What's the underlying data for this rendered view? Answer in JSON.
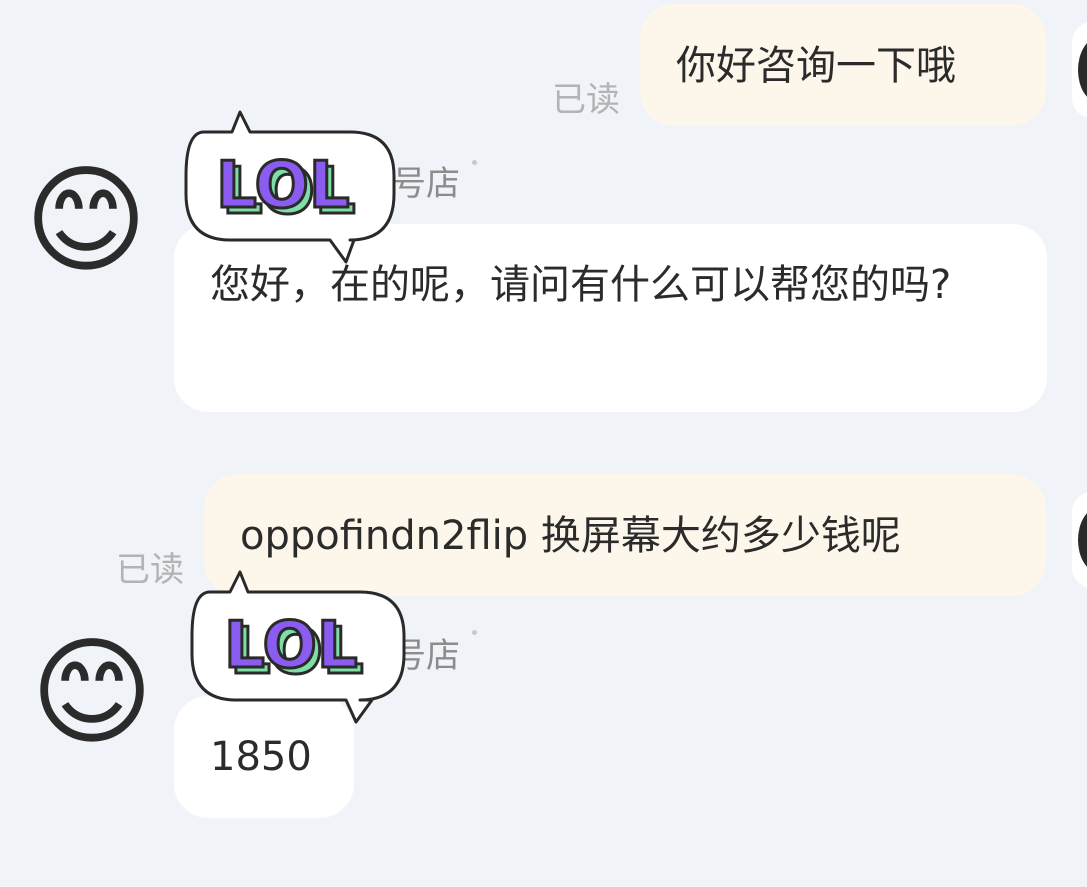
{
  "messages": [
    {
      "side": "outgoing",
      "text": "你好咨询一下哦",
      "status": "已读"
    },
    {
      "side": "incoming",
      "shop_name_visible": "号店",
      "text": "您好，在的呢，请问有什么可以帮您的吗?"
    },
    {
      "side": "outgoing",
      "text": "oppofindn2flip 换屏幕大约多少钱呢",
      "status": "已读"
    },
    {
      "side": "incoming",
      "shop_name_visible": "号店",
      "text": "1850"
    }
  ],
  "sticker": {
    "text": "LOL",
    "letter_color": "#8a5cf0",
    "shadow_color": "#7ddfa6",
    "outline_color": "#2a2a2a"
  },
  "avatar": {
    "icon": "smiling-face-icon",
    "emoji": "😊"
  },
  "colors": {
    "background": "#f0f3f8",
    "outgoing_bubble": "#fdf6ea",
    "incoming_bubble": "#ffffff",
    "read_status": "#b3b3b3"
  }
}
